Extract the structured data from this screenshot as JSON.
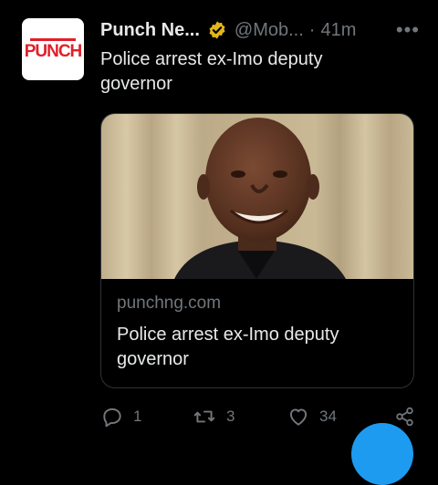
{
  "tweet": {
    "author_name": "Punch Ne...",
    "handle": "@Mob...",
    "separator": "·",
    "time": "41m",
    "more": "•••",
    "text": "Police arrest ex-Imo deputy governor",
    "avatar_logo": "PUNCH"
  },
  "card": {
    "domain": "punchng.com",
    "title": "Police arrest ex-Imo deputy governor"
  },
  "actions": {
    "replies": "1",
    "retweets": "3",
    "likes": "34"
  },
  "colors": {
    "background": "#000000",
    "verified_badge": "#e2b719",
    "fab": "#1d9bf0",
    "brand_red": "#e0202a"
  }
}
